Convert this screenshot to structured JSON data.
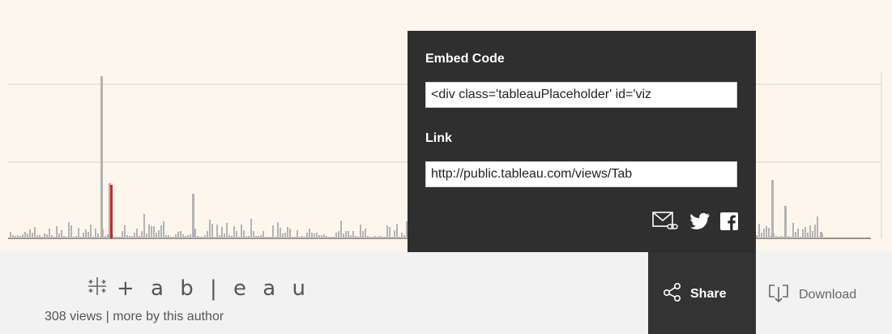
{
  "embed": {
    "embed_label": "Embed Code",
    "embed_value": "<div class='tableauPlaceholder' id='viz",
    "link_label": "Link",
    "link_value": "http://public.tableau.com/views/Tab"
  },
  "share_icons": [
    "email-link-icon",
    "twitter-icon",
    "facebook-icon"
  ],
  "toolbar": {
    "share_label": "Share",
    "download_label": "Download"
  },
  "footer": {
    "brand": "+ a b | e a u",
    "views": "308 views",
    "separator": "|",
    "more_link": "more by this author"
  },
  "colors": {
    "viz_background": "#fcf6ed",
    "bar": "#b3b3b3",
    "highlight_bar": "#e02020",
    "panel": "#2a2a2a",
    "share_tab": "#333333",
    "footer": "#f2f2f2"
  }
}
